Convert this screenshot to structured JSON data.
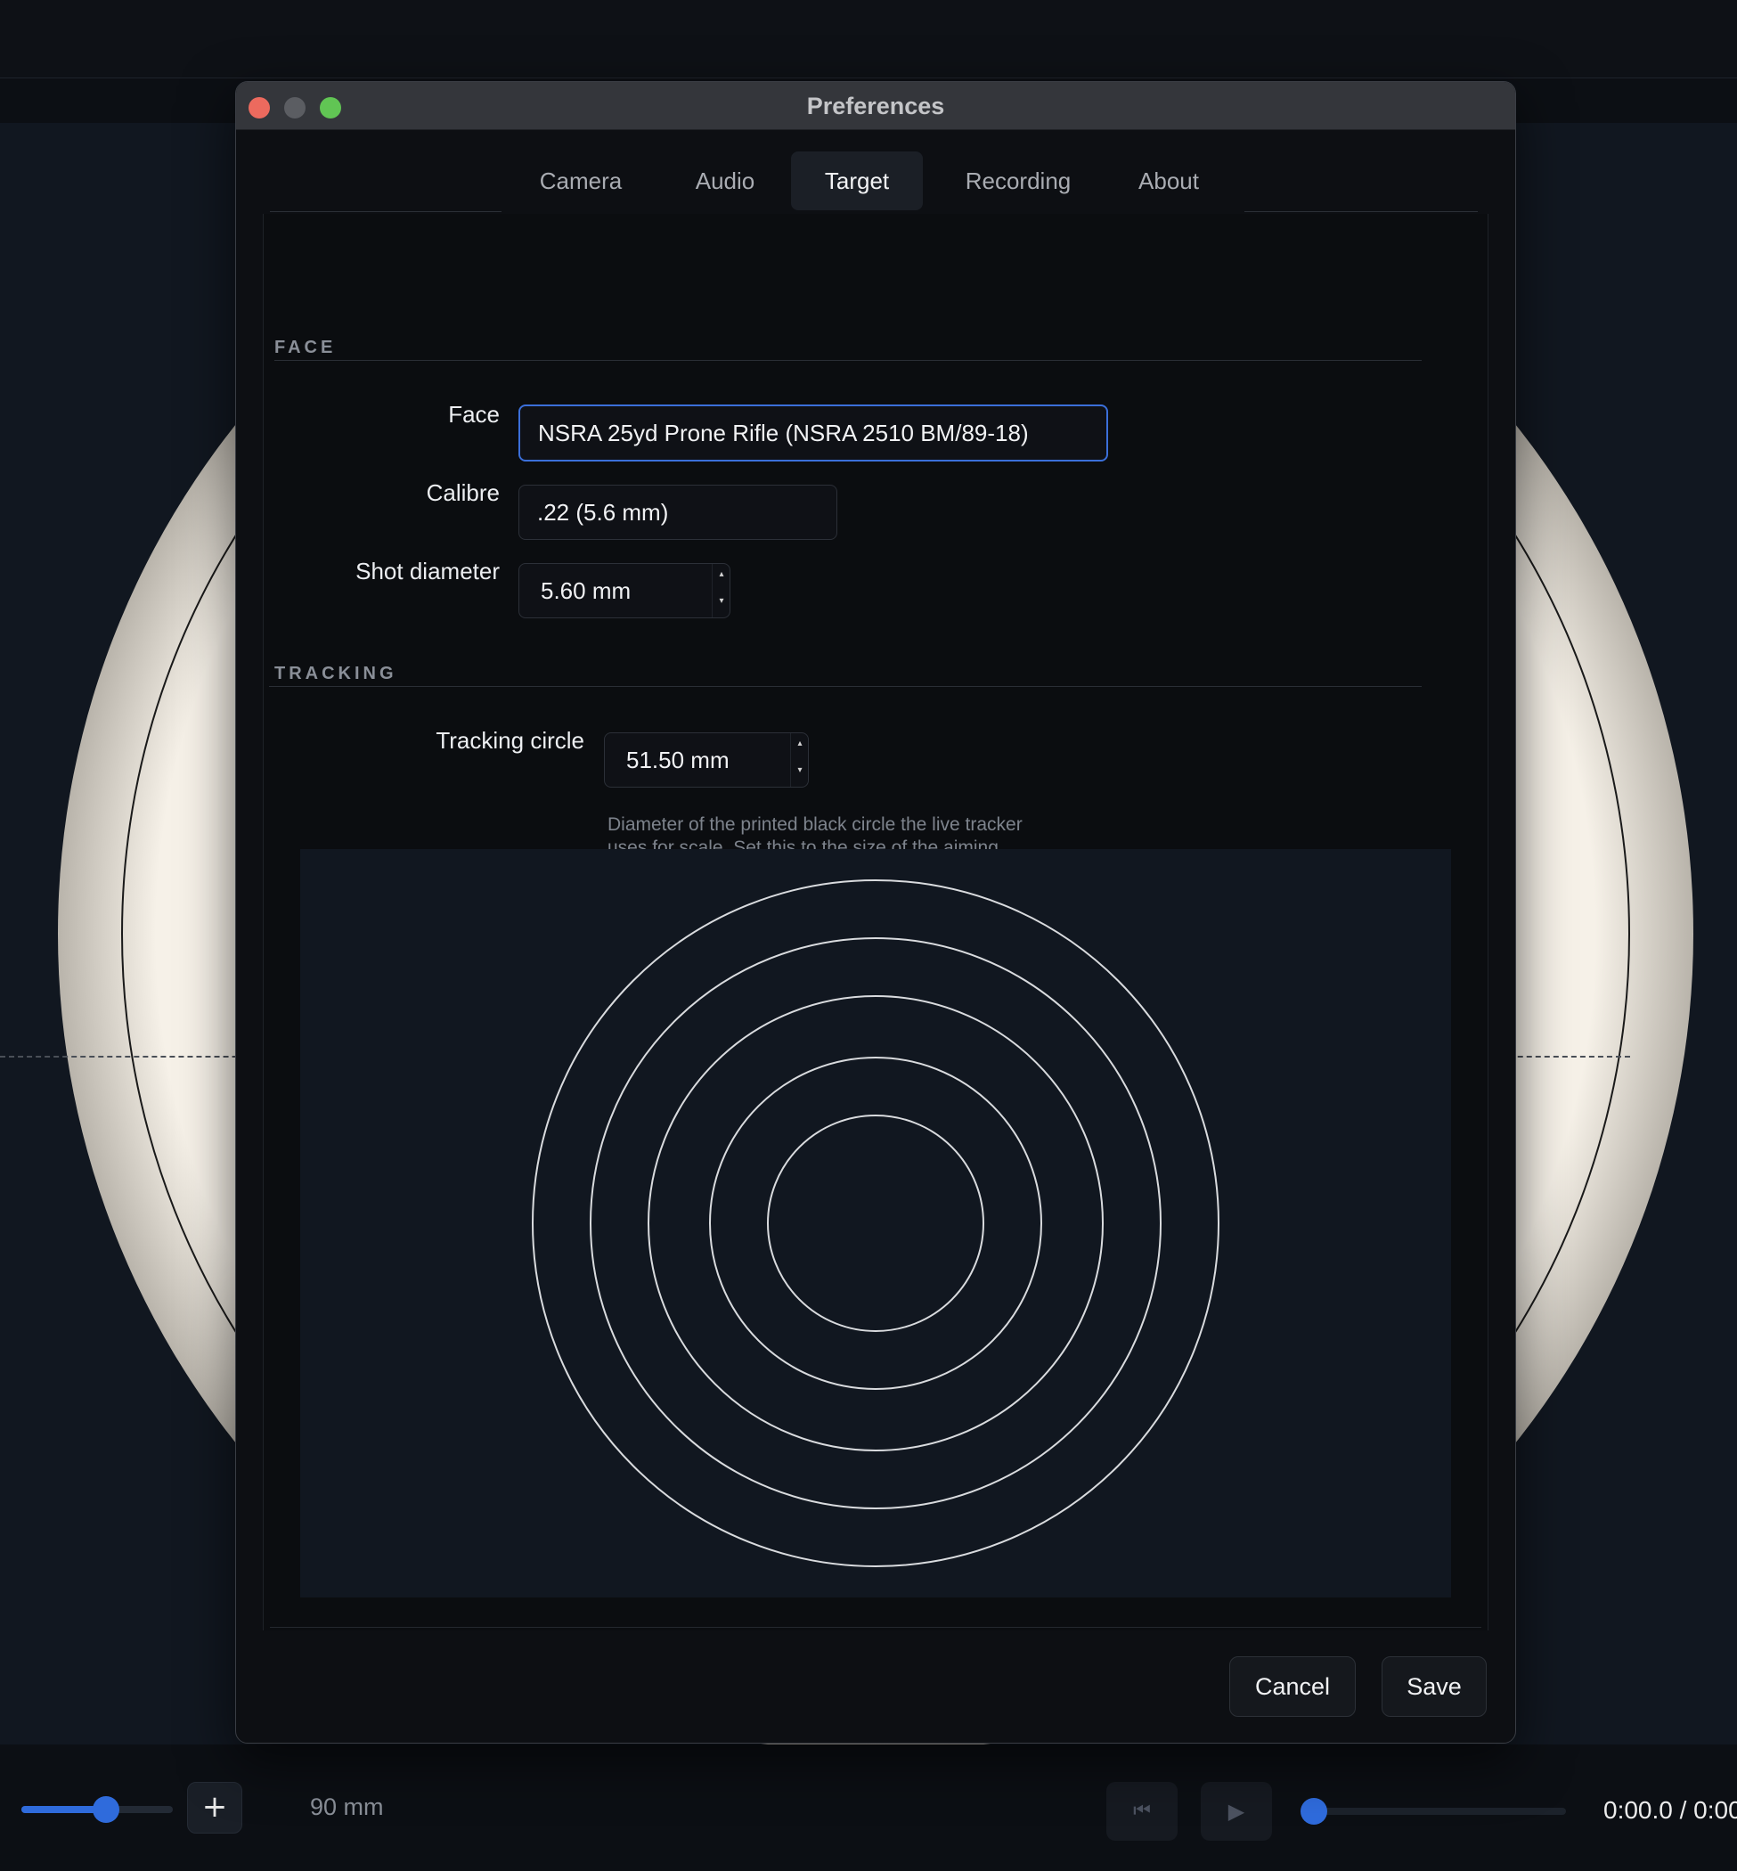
{
  "window": {
    "title": "Preferences"
  },
  "tabs": [
    {
      "label": "Camera",
      "active": false
    },
    {
      "label": "Audio",
      "active": false
    },
    {
      "label": "Target",
      "active": true
    },
    {
      "label": "Recording",
      "active": false
    },
    {
      "label": "About",
      "active": false
    }
  ],
  "face_section": {
    "title": "FACE",
    "face": {
      "label": "Face",
      "value": "NSRA 25yd Prone Rifle (NSRA 2510 BM/89-18)"
    },
    "calibre": {
      "label": "Calibre",
      "value": ".22 (5.6 mm)"
    },
    "shot_diameter": {
      "label": "Shot diameter",
      "value": "5.60 mm"
    }
  },
  "tracking_section": {
    "title": "TRACKING",
    "tracking_circle": {
      "label": "Tracking circle",
      "value": "51.50 mm"
    },
    "help": "Diameter of the printed black circle the live tracker uses for scale. Set this to the size of the aiming mark you're shooting at."
  },
  "buttons": {
    "cancel": "Cancel",
    "save": "Save"
  },
  "bottom_bar": {
    "zoom_value": "90 mm",
    "zoom_slider_fraction": 0.57,
    "plus_label": "+",
    "skip_back_icon": "skip-back-icon",
    "play_icon": "play-icon",
    "timeline_fraction": 0.0,
    "time_readout": "0:00.0 / 0:00"
  },
  "colors": {
    "accent": "#2f6bdc",
    "focus_ring": "#3b6fd9",
    "traffic_close": "#ec6a5e",
    "traffic_max": "#61c554",
    "target_paper": "#f4efe6"
  }
}
